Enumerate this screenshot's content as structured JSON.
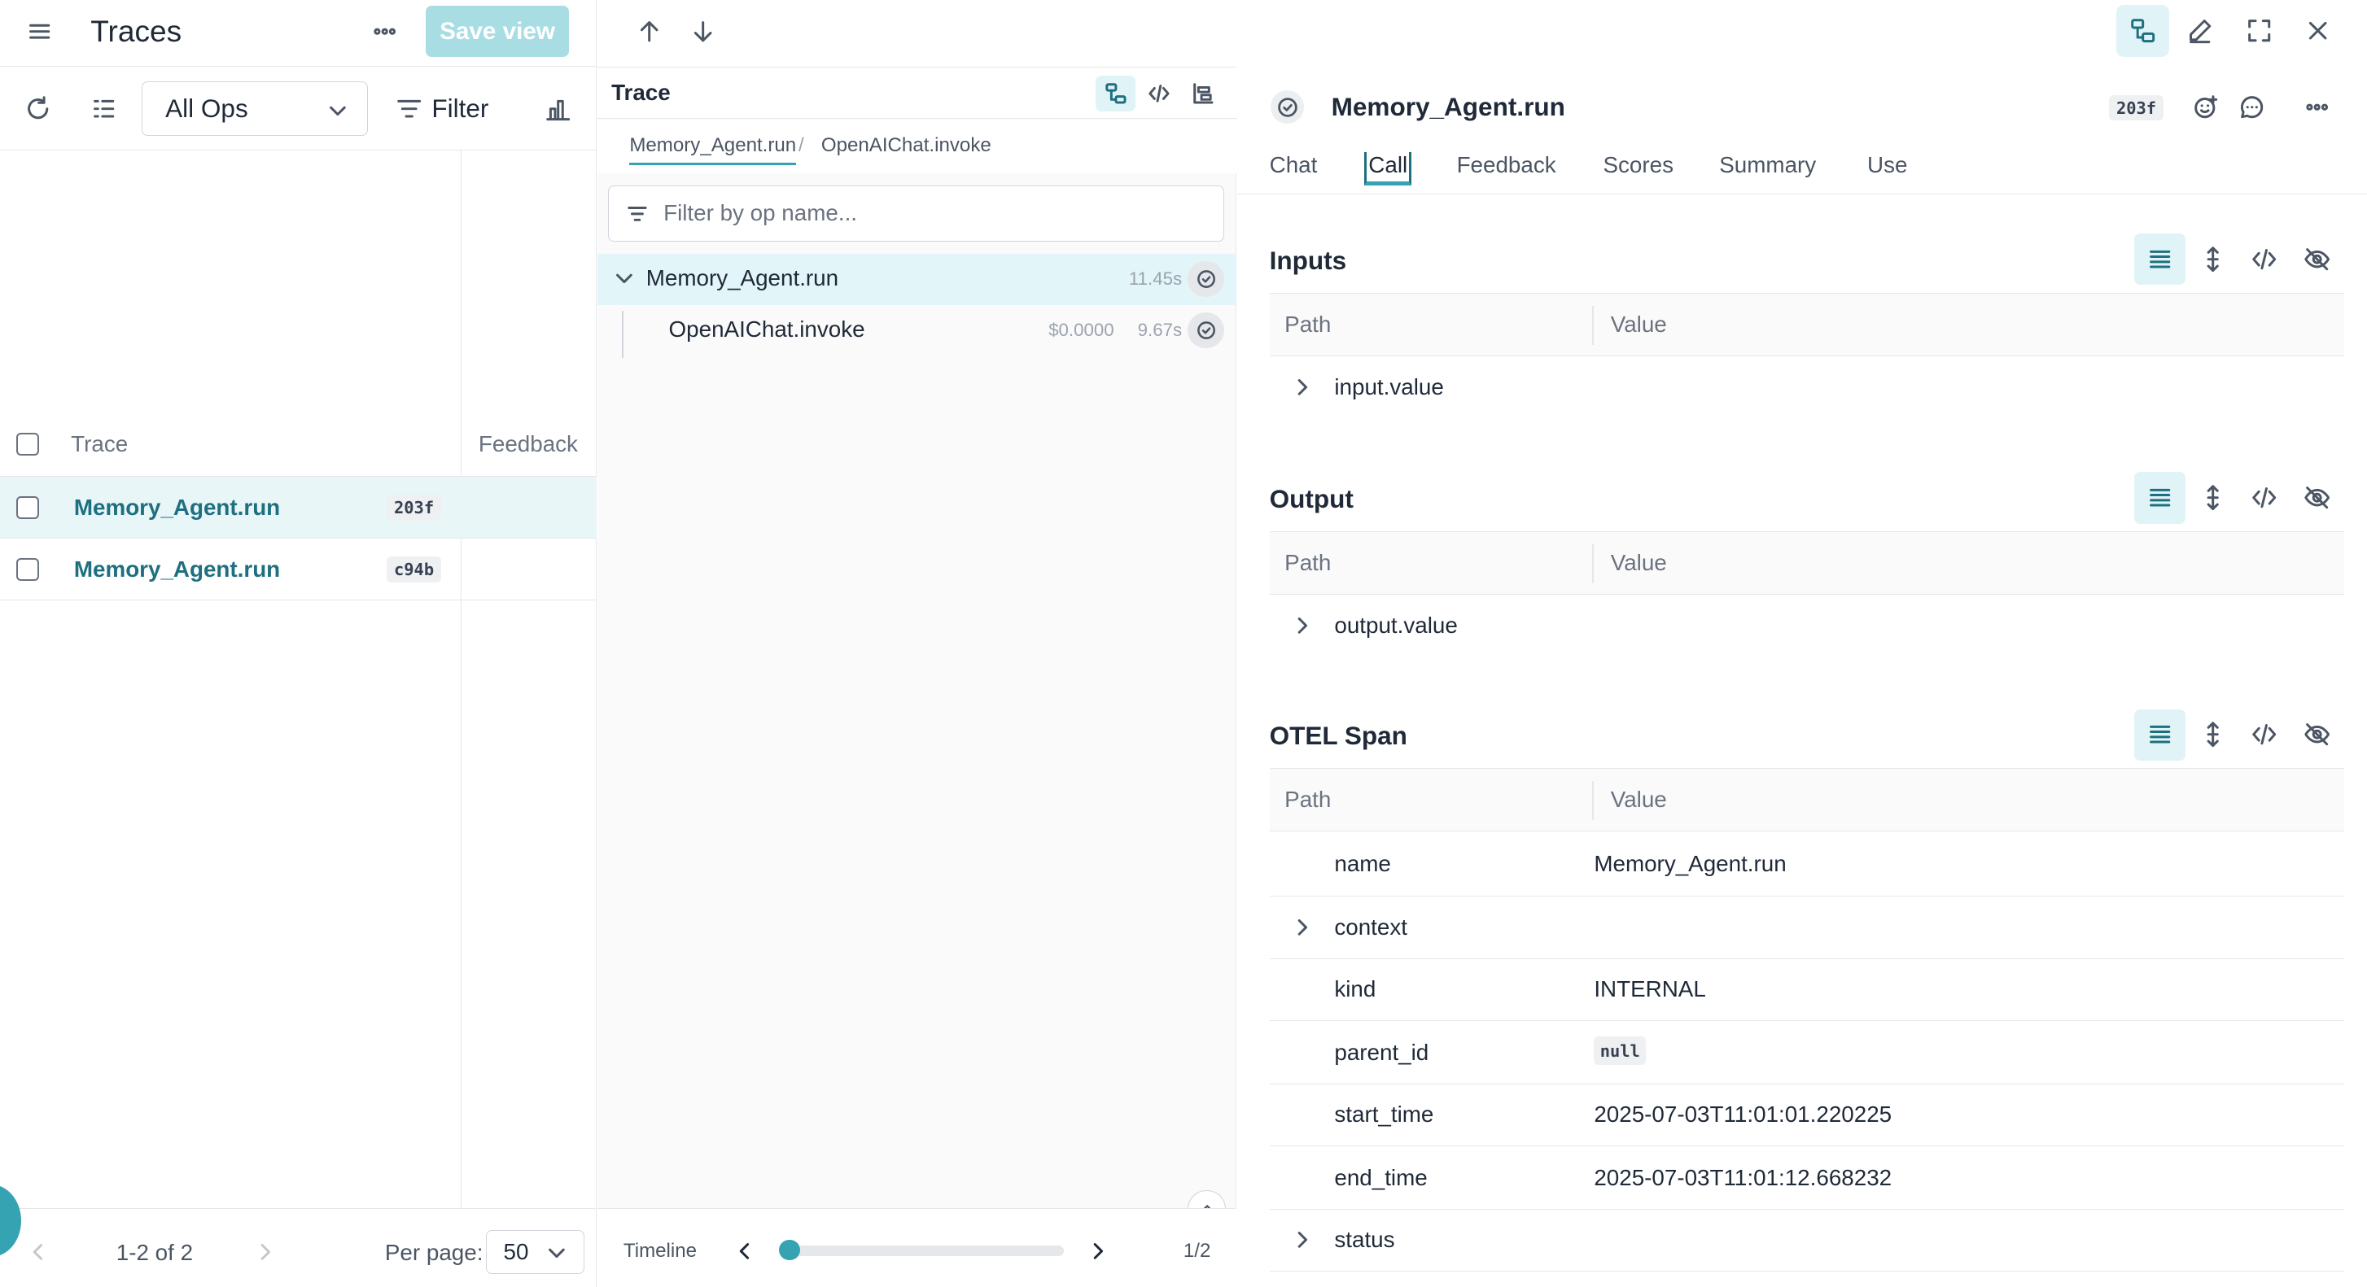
{
  "left": {
    "title": "Traces",
    "save_view": "Save view",
    "ops_select": "All Ops",
    "filter": "Filter",
    "columns": {
      "trace": "Trace",
      "feedback": "Feedback"
    },
    "rows": [
      {
        "name": "Memory_Agent.run",
        "id": "203f",
        "selected": true
      },
      {
        "name": "Memory_Agent.run",
        "id": "c94b",
        "selected": false
      }
    ],
    "pagination": {
      "range": "1-2 of 2",
      "per_page_label": "Per page:",
      "per_page": "50"
    }
  },
  "trace": {
    "title": "Trace",
    "breadcrumbs": [
      "Memory_Agent.run",
      "OpenAIChat.invoke"
    ],
    "breadcrumb_sep": "/",
    "search_placeholder": "Filter by op name...",
    "ops": [
      {
        "name": "Memory_Agent.run",
        "cost": "",
        "duration": "11.45s",
        "selected": true
      },
      {
        "name": "OpenAIChat.invoke",
        "cost": "$0.0000",
        "duration": "9.67s",
        "selected": false
      }
    ],
    "timeline": {
      "label": "Timeline",
      "position": "1/2"
    }
  },
  "call": {
    "title": "Memory_Agent.run",
    "id": "203f",
    "tabs": [
      "Chat",
      "Call",
      "Feedback",
      "Scores",
      "Summary",
      "Use"
    ],
    "active_tab": "Call",
    "table_headers": {
      "path": "Path",
      "value": "Value"
    },
    "inputs": {
      "title": "Inputs",
      "rows": [
        {
          "key": "input.value",
          "value": ""
        }
      ]
    },
    "output": {
      "title": "Output",
      "rows": [
        {
          "key": "output.value",
          "value": ""
        }
      ]
    },
    "otel": {
      "title": "OTEL Span",
      "rows": [
        {
          "key": "name",
          "value": "Memory_Agent.run"
        },
        {
          "key": "context",
          "value": ""
        },
        {
          "key": "kind",
          "value": "INTERNAL"
        },
        {
          "key": "parent_id",
          "value": "null"
        },
        {
          "key": "start_time",
          "value": "2025-07-03T11:01:01.220225"
        },
        {
          "key": "end_time",
          "value": "2025-07-03T11:01:12.668232"
        },
        {
          "key": "status",
          "value": ""
        }
      ]
    }
  },
  "colors": {
    "accent": "#36a3b3",
    "accent_light": "#e0f4f7",
    "link": "#1e6f80"
  }
}
